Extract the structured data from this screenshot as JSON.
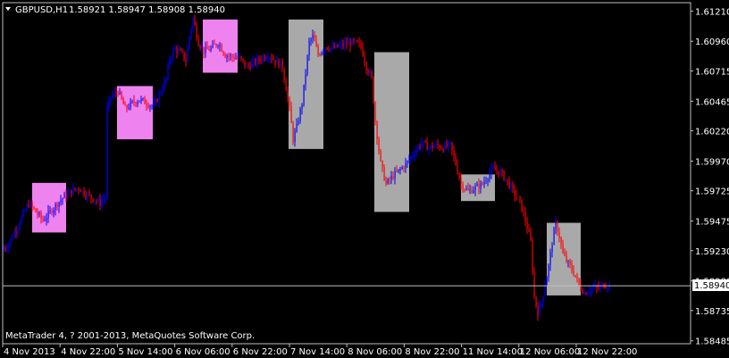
{
  "header": {
    "symbol_label": "GBPUSD,H1",
    "ohlc_text": "1.58921 1.58947 1.58908 1.58940"
  },
  "footer": {
    "copyright": "MetaTrader 4, ? 2001-2013, MetaQuotes Software Corp."
  },
  "colors": {
    "background": "#000000",
    "frame": "#c0c0c0",
    "up_candle": "#0000ff",
    "down_candle": "#ff0000",
    "box_pink": "#ee82ee",
    "box_gray": "#a9a9a9",
    "bid_line": "#c0c0c0",
    "text": "#ffffff"
  },
  "chart_data": {
    "type": "candlestick",
    "symbol": "GBPUSD",
    "timeframe": "H1",
    "ylim": [
      1.5846,
      1.6128
    ],
    "y_ticks": [
      "1.61210",
      "1.60960",
      "1.60715",
      "1.60465",
      "1.60220",
      "1.59970",
      "1.59725",
      "1.59475",
      "1.59230",
      "1.58980",
      "1.58735",
      "1.58485"
    ],
    "current_price": "1.58940",
    "x_ticks": [
      "4 Nov 2013",
      "4 Nov 22:00",
      "5 Nov 14:00",
      "6 Nov 06:00",
      "6 Nov 22:00",
      "7 Nov 14:00",
      "8 Nov 06:00",
      "8 Nov 22:00",
      "11 Nov 14:00",
      "12 Nov 06:00",
      "12 Nov 22:00"
    ],
    "path": [
      [
        0,
        1.5923
      ],
      [
        8,
        1.5927
      ],
      [
        16,
        1.5938
      ],
      [
        24,
        1.595
      ],
      [
        32,
        1.5962
      ],
      [
        40,
        1.5955
      ],
      [
        48,
        1.5948
      ],
      [
        56,
        1.5955
      ],
      [
        64,
        1.5962
      ],
      [
        72,
        1.5968
      ],
      [
        80,
        1.5972
      ],
      [
        88,
        1.5975
      ],
      [
        96,
        1.597
      ],
      [
        104,
        1.5966
      ],
      [
        112,
        1.5962
      ],
      [
        118,
        1.5968
      ],
      [
        120,
        1.604
      ],
      [
        124,
        1.605
      ],
      [
        132,
        1.6055
      ],
      [
        140,
        1.604
      ],
      [
        148,
        1.6045
      ],
      [
        156,
        1.6048
      ],
      [
        164,
        1.6045
      ],
      [
        172,
        1.6042
      ],
      [
        180,
        1.6055
      ],
      [
        186,
        1.6065
      ],
      [
        190,
        1.6082
      ],
      [
        196,
        1.609
      ],
      [
        204,
        1.6085
      ],
      [
        208,
        1.608
      ],
      [
        212,
        1.61
      ],
      [
        216,
        1.6115
      ],
      [
        222,
        1.6095
      ],
      [
        228,
        1.6088
      ],
      [
        236,
        1.609
      ],
      [
        244,
        1.6095
      ],
      [
        252,
        1.6085
      ],
      [
        260,
        1.6083
      ],
      [
        268,
        1.6082
      ],
      [
        276,
        1.6075
      ],
      [
        284,
        1.6078
      ],
      [
        292,
        1.6082
      ],
      [
        300,
        1.6085
      ],
      [
        308,
        1.608
      ],
      [
        316,
        1.6075
      ],
      [
        324,
        1.604
      ],
      [
        328,
        1.6015
      ],
      [
        332,
        1.6025
      ],
      [
        338,
        1.6045
      ],
      [
        342,
        1.607
      ],
      [
        346,
        1.6095
      ],
      [
        350,
        1.61
      ],
      [
        356,
        1.6085
      ],
      [
        364,
        1.6092
      ],
      [
        372,
        1.609
      ],
      [
        380,
        1.6092
      ],
      [
        388,
        1.6094
      ],
      [
        396,
        1.6095
      ],
      [
        404,
        1.6092
      ],
      [
        410,
        1.6075
      ],
      [
        416,
        1.6065
      ],
      [
        420,
        1.603
      ],
      [
        426,
        1.5995
      ],
      [
        432,
        1.5978
      ],
      [
        440,
        1.5985
      ],
      [
        448,
        1.599
      ],
      [
        456,
        1.5996
      ],
      [
        464,
        1.6005
      ],
      [
        472,
        1.6012
      ],
      [
        480,
        1.6008
      ],
      [
        488,
        1.601
      ],
      [
        496,
        1.6008
      ],
      [
        504,
        1.601
      ],
      [
        510,
        1.5995
      ],
      [
        516,
        1.5978
      ],
      [
        524,
        1.5972
      ],
      [
        532,
        1.5975
      ],
      [
        540,
        1.5978
      ],
      [
        546,
        1.5985
      ],
      [
        552,
        1.599
      ],
      [
        560,
        1.5988
      ],
      [
        568,
        1.598
      ],
      [
        576,
        1.597
      ],
      [
        582,
        1.5963
      ],
      [
        588,
        1.5948
      ],
      [
        594,
        1.593
      ],
      [
        598,
        1.5885
      ],
      [
        602,
        1.5872
      ],
      [
        606,
        1.588
      ],
      [
        610,
        1.5895
      ],
      [
        614,
        1.591
      ],
      [
        618,
        1.593
      ],
      [
        622,
        1.5945
      ],
      [
        626,
        1.5935
      ],
      [
        630,
        1.592
      ],
      [
        636,
        1.5912
      ],
      [
        642,
        1.5905
      ],
      [
        648,
        1.5895
      ],
      [
        654,
        1.5888
      ],
      [
        662,
        1.5892
      ],
      [
        670,
        1.5892
      ],
      [
        676,
        1.5895
      ],
      [
        682,
        1.5894
      ]
    ],
    "boxes": [
      {
        "color": "pink",
        "x": [
          36,
          74
        ],
        "y": [
          1.5938,
          1.5979
        ]
      },
      {
        "color": "pink",
        "x": [
          131,
          171
        ],
        "y": [
          1.6015,
          1.6059
        ]
      },
      {
        "color": "pink",
        "x": [
          227,
          266
        ],
        "y": [
          1.607,
          1.6114
        ]
      },
      {
        "color": "gray",
        "x": [
          323,
          362
        ],
        "y": [
          1.6007,
          1.6114
        ]
      },
      {
        "color": "gray",
        "x": [
          419,
          458
        ],
        "y": [
          1.5955,
          1.6087
        ]
      },
      {
        "color": "gray",
        "x": [
          516,
          554
        ],
        "y": [
          1.5964,
          1.5986
        ]
      },
      {
        "color": "gray",
        "x": [
          612,
          650
        ],
        "y": [
          1.5886,
          1.5946
        ]
      }
    ]
  }
}
